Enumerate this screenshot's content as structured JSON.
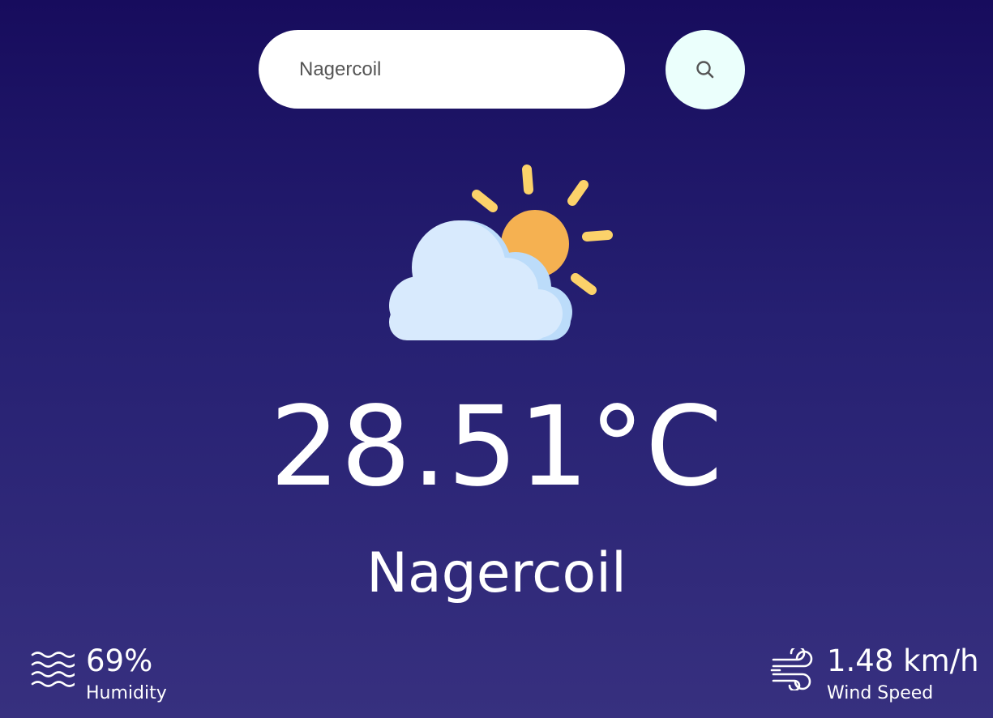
{
  "search": {
    "value": "Nagercoil",
    "placeholder": "",
    "button_icon": "search-icon"
  },
  "weather": {
    "icon": "partly-cloudy-icon",
    "temperature": "28.51°C",
    "city": "Nagercoil"
  },
  "details": {
    "humidity": {
      "icon": "humidity-icon",
      "value": "69%",
      "label": "Humidity"
    },
    "wind": {
      "icon": "wind-icon",
      "value": "1.48 km/h",
      "label": "Wind Speed"
    }
  },
  "colors": {
    "background_top": "#170c5d",
    "background_bottom": "#37307f",
    "search_button_bg": "#ebfffc",
    "sun": "#f5b151",
    "sun_rays": "#fcd26a",
    "cloud": "#d8eafd",
    "cloud_shade": "#bcdcfa"
  }
}
